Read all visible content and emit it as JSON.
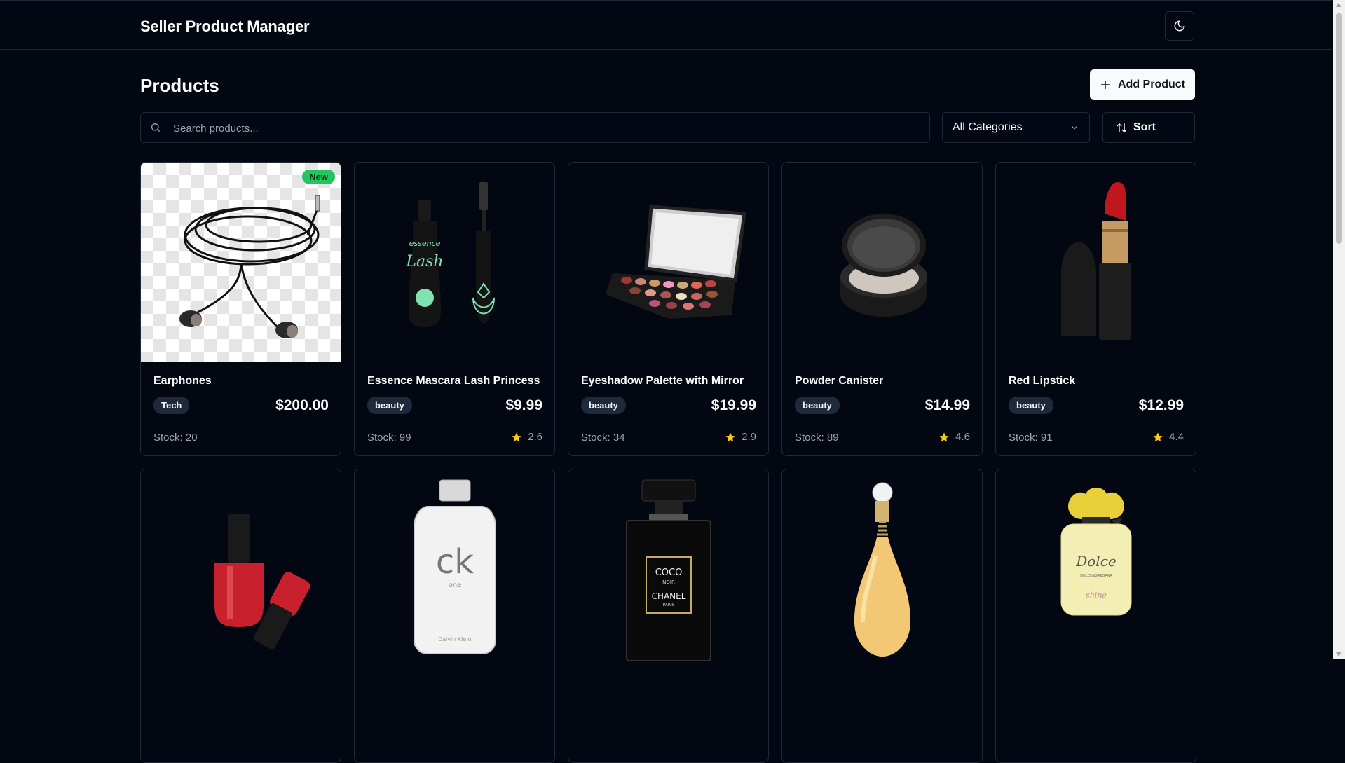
{
  "header": {
    "title": "Seller Product Manager",
    "theme_toggle_icon": "moon-icon"
  },
  "toolbar": {
    "page_title": "Products",
    "add_label": "Add Product",
    "search_placeholder": "Search products...",
    "category_value": "All Categories",
    "sort_label": "Sort"
  },
  "colors": {
    "background": "#030712",
    "border": "#1f2937",
    "new_badge": "#22c55e",
    "star": "#facc15"
  },
  "products": [
    {
      "name": "Earphones",
      "category": "Tech",
      "price": "$200.00",
      "stock": "Stock: 20",
      "rating": "",
      "badge": "New",
      "icon": "earphones-image"
    },
    {
      "name": "Essence Mascara Lash Princess",
      "category": "beauty",
      "price": "$9.99",
      "stock": "Stock: 99",
      "rating": "2.6",
      "badge": "",
      "icon": "mascara-image"
    },
    {
      "name": "Eyeshadow Palette with Mirror",
      "category": "beauty",
      "price": "$19.99",
      "stock": "Stock: 34",
      "rating": "2.9",
      "badge": "",
      "icon": "eyeshadow-palette-image"
    },
    {
      "name": "Powder Canister",
      "category": "beauty",
      "price": "$14.99",
      "stock": "Stock: 89",
      "rating": "4.6",
      "badge": "",
      "icon": "powder-canister-image"
    },
    {
      "name": "Red Lipstick",
      "category": "beauty",
      "price": "$12.99",
      "stock": "Stock: 91",
      "rating": "4.4",
      "badge": "",
      "icon": "lipstick-image"
    },
    {
      "name": "",
      "category": "",
      "price": "",
      "stock": "",
      "rating": "",
      "badge": "",
      "icon": "nail-polish-image"
    },
    {
      "name": "",
      "category": "",
      "price": "",
      "stock": "",
      "rating": "",
      "badge": "",
      "icon": "ck-one-perfume-image",
      "label_lines": [
        "ck",
        "one",
        "Calvin Klein"
      ]
    },
    {
      "name": "",
      "category": "",
      "price": "",
      "stock": "",
      "rating": "",
      "badge": "",
      "icon": "chanel-perfume-image",
      "label_lines": [
        "COCO",
        "NOIR",
        "CHANEL",
        "PARIS"
      ]
    },
    {
      "name": "",
      "category": "",
      "price": "",
      "stock": "",
      "rating": "",
      "badge": "",
      "icon": "dior-perfume-image"
    },
    {
      "name": "",
      "category": "",
      "price": "",
      "stock": "",
      "rating": "",
      "badge": "",
      "icon": "dolce-shine-perfume-image",
      "label_lines": [
        "Dolce",
        "DOLCE&GABBANA",
        "shine"
      ]
    }
  ]
}
